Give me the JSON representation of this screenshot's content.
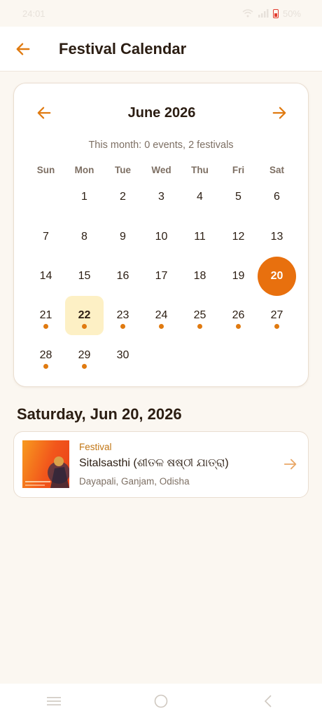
{
  "status_bar": {
    "time": "24:01",
    "battery": "50%"
  },
  "app_bar": {
    "title": "Festival Calendar"
  },
  "calendar": {
    "month_title": "June 2026",
    "summary": "This month: 0 events, 2 festivals",
    "weekdays": [
      "Sun",
      "Mon",
      "Tue",
      "Wed",
      "Thu",
      "Fri",
      "Sat"
    ],
    "leading_blanks": 1,
    "days_in_month": 30,
    "today": 22,
    "selected": 20,
    "days_with_dots": [
      21,
      22,
      23,
      24,
      25,
      26,
      27,
      28,
      29
    ],
    "accent_color": "#e8700e",
    "today_bg_color": "#fdf0c5"
  },
  "selected_date_label": "Saturday, Jun 20, 2026",
  "event": {
    "category": "Festival",
    "title": "Sitalsasthi (ଶୀତଳ ଷଷ୍ଠୀ ଯାତ୍ରା)",
    "location": "Dayapali, Ganjam, Odisha",
    "thumbnail_text": "ଯାତ୍ରା"
  }
}
